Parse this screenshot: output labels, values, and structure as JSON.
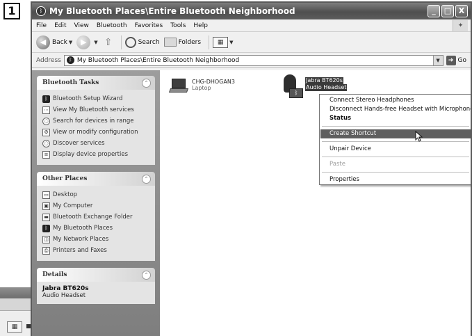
{
  "step_number": "1",
  "window": {
    "title": "My Bluetooth Places\\Entire Bluetooth Neighborhood",
    "buttons": {
      "minimize": "_",
      "maximize": "□",
      "close": "X"
    }
  },
  "menu": [
    "File",
    "Edit",
    "View",
    "Bluetooth",
    "Favorites",
    "Tools",
    "Help"
  ],
  "toolbar": {
    "back": "Back",
    "search": "Search",
    "folders": "Folders"
  },
  "address": {
    "label": "Address",
    "value": "My Bluetooth Places\\Entire Bluetooth Neighborhood",
    "go": "Go"
  },
  "tasks": {
    "bluetooth": {
      "title": "Bluetooth Tasks",
      "items": [
        "Bluetooth Setup Wizard",
        "View My Bluetooth services",
        "Search for devices in range",
        "View or modify configuration",
        "Discover services",
        "Display device properties"
      ]
    },
    "other": {
      "title": "Other Places",
      "items": [
        "Desktop",
        "My Computer",
        "Bluetooth Exchange Folder",
        "My Bluetooth Places",
        "My Network Places",
        "Printers and Faxes"
      ]
    },
    "details": {
      "title": "Details",
      "name": "Jabra BT620s",
      "type": "Audio Headset"
    }
  },
  "devices": [
    {
      "name": "CHG-DHOGAN3",
      "type": "Laptop",
      "icon": "laptop-icon"
    },
    {
      "name": "Jabra BT620s",
      "type": "Audio Headset",
      "icon": "headset-icon"
    }
  ],
  "context_menu": {
    "items": [
      "Connect Stereo Headphones",
      "Disconnect Hands-free Headset with Microphone",
      "Status",
      "Create Shortcut",
      "Unpair Device",
      "Paste",
      "Properties"
    ],
    "highlighted": "Create Shortcut",
    "disabled": "Paste"
  },
  "colors": {
    "titlebar": "#5a5a5a",
    "taskpane": "#8c8c8c",
    "highlight": "#5f5f5f"
  }
}
